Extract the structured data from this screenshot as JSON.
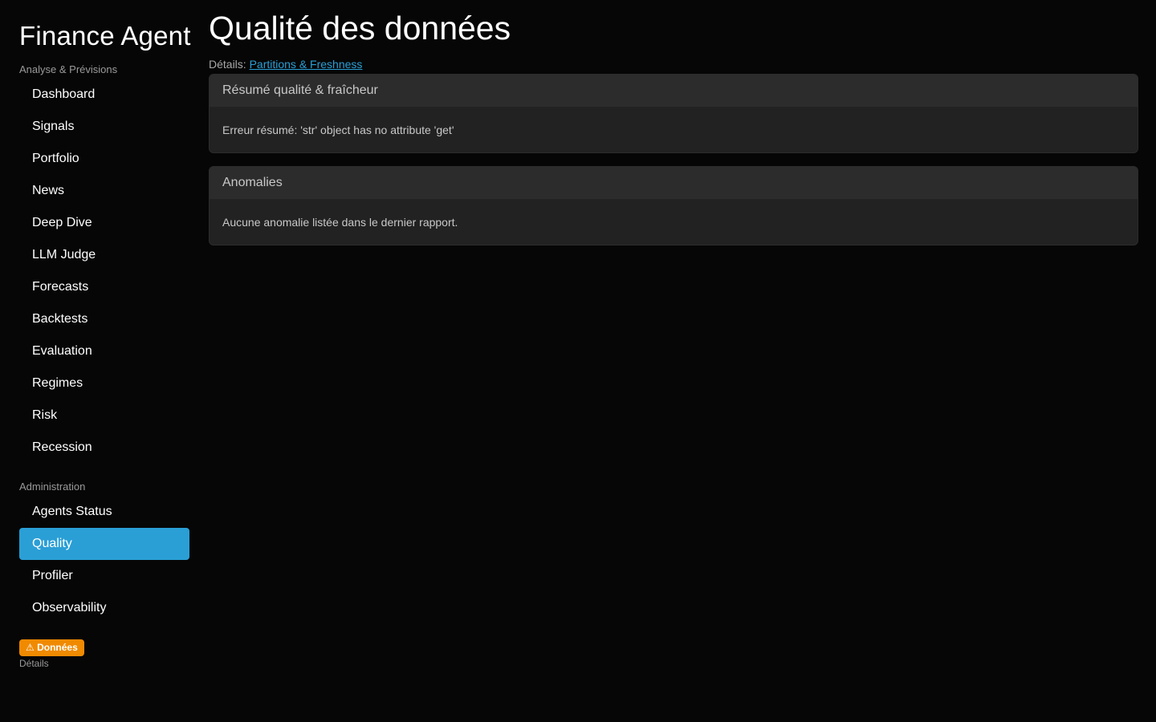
{
  "sidebar": {
    "brand": "Finance Agent",
    "section_analysis": "Analyse & Prévisions",
    "analysis_items": [
      {
        "label": "Dashboard"
      },
      {
        "label": "Signals"
      },
      {
        "label": "Portfolio"
      },
      {
        "label": "News"
      },
      {
        "label": "Deep Dive"
      },
      {
        "label": "LLM Judge"
      },
      {
        "label": "Forecasts"
      },
      {
        "label": "Backtests"
      },
      {
        "label": "Evaluation"
      },
      {
        "label": "Regimes"
      },
      {
        "label": "Risk"
      },
      {
        "label": "Recession"
      }
    ],
    "section_admin": "Administration",
    "admin_items": [
      {
        "label": "Agents Status"
      },
      {
        "label": "Quality",
        "active": true
      },
      {
        "label": "Profiler"
      },
      {
        "label": "Observability"
      }
    ],
    "badge": "⚠ Données",
    "badge_sub": "Détails"
  },
  "main": {
    "title": "Qualité des données",
    "details_prefix": "Détails:",
    "details_link": "Partitions & Freshness",
    "cards": [
      {
        "header": "Résumé qualité & fraîcheur",
        "body": "Erreur résumé: 'str' object has no attribute 'get'"
      },
      {
        "header": "Anomalies",
        "body": "Aucune anomalie listée dans le dernier rapport."
      }
    ]
  },
  "colors": {
    "background": "#060606",
    "accent": "#2a9fd6",
    "warning": "#f08a00",
    "card": "#222222"
  }
}
